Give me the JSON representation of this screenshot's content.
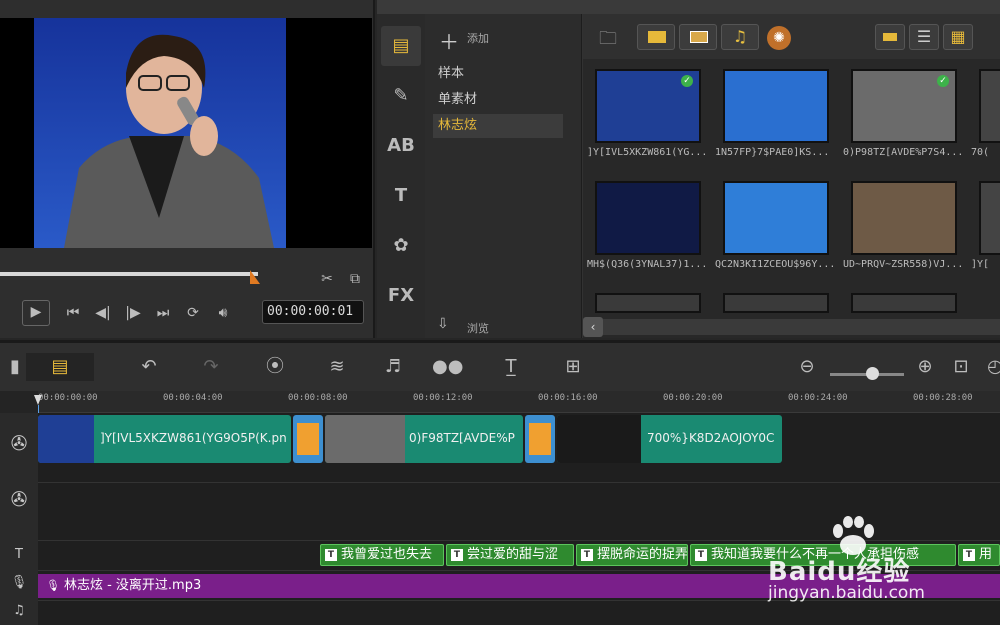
{
  "preview": {
    "timecode": "00:00:00:01",
    "progress": 0.67
  },
  "library": {
    "add_label": "添加",
    "browse_label": "浏览",
    "folders": [
      {
        "label": "样本",
        "selected": false
      },
      {
        "label": "单素材",
        "selected": false
      },
      {
        "label": "林志炫",
        "selected": true
      }
    ],
    "tabs": [
      {
        "name": "media-tab",
        "glyph": "▤"
      },
      {
        "name": "instant-project-tab",
        "glyph": "✎"
      },
      {
        "name": "transition-tab",
        "glyph": "AB"
      },
      {
        "name": "title-tab",
        "glyph": "T"
      },
      {
        "name": "graphic-tab",
        "glyph": "✿"
      },
      {
        "name": "filter-tab",
        "glyph": "FX"
      }
    ],
    "thumbnails": [
      {
        "label": "]Y[IVL5XKZW861(YG...",
        "checked": true,
        "bg": "#1f3f95"
      },
      {
        "label": "1N57FP}7$PAE0]KS...",
        "checked": false,
        "bg": "#2a6fd0"
      },
      {
        "label": "0)P98TZ[AVDE%P7S4...",
        "checked": true,
        "bg": "#6b6b6b"
      },
      {
        "label": "70(",
        "checked": false,
        "bg": "#444"
      },
      {
        "label": "MH$(Q36(3YNAL37)1...",
        "checked": false,
        "bg": "#101a45"
      },
      {
        "label": "QC2N3KI1ZCEOU$96Y...",
        "checked": false,
        "bg": "#2f7ed8"
      },
      {
        "label": "UD~PRQV~ZSR558)VJ...",
        "checked": false,
        "bg": "#6e5a46"
      },
      {
        "label": "]Y[",
        "checked": false,
        "bg": "#444"
      }
    ]
  },
  "timeline": {
    "ticks": [
      "00:00:00:00",
      "00:00:04:00",
      "00:00:08:00",
      "00:00:12:00",
      "00:00:16:00",
      "00:00:20:00",
      "00:00:24:00",
      "00:00:28:00"
    ],
    "video_clips": [
      {
        "label": "]Y[IVL5XKZW861(YG9O5P(K.pn",
        "thumb": "#1f3f95"
      },
      {
        "label": "0)F98TZ[AVDE%P",
        "thumb": "#6b6b6b"
      },
      {
        "label": "700%}K8D2AOJOY0C",
        "thumb": "#1a1a1a"
      }
    ],
    "title_clips": [
      "我曾爱过也失去",
      "尝过爱的甜与涩",
      "摆脱命运的捉弄",
      "我知道我要什么不再一个人承担伤感",
      "用"
    ],
    "music_clip": "林志炫 - 没离开过.mp3"
  },
  "watermark": {
    "brand": "Baidu经验",
    "url": "jingyan.baidu.com"
  },
  "colors": {
    "accent": "#e07a22",
    "video_clip": "#1a8a72",
    "title_clip": "#2f8a2f",
    "music_clip": "#7a1f8a"
  }
}
